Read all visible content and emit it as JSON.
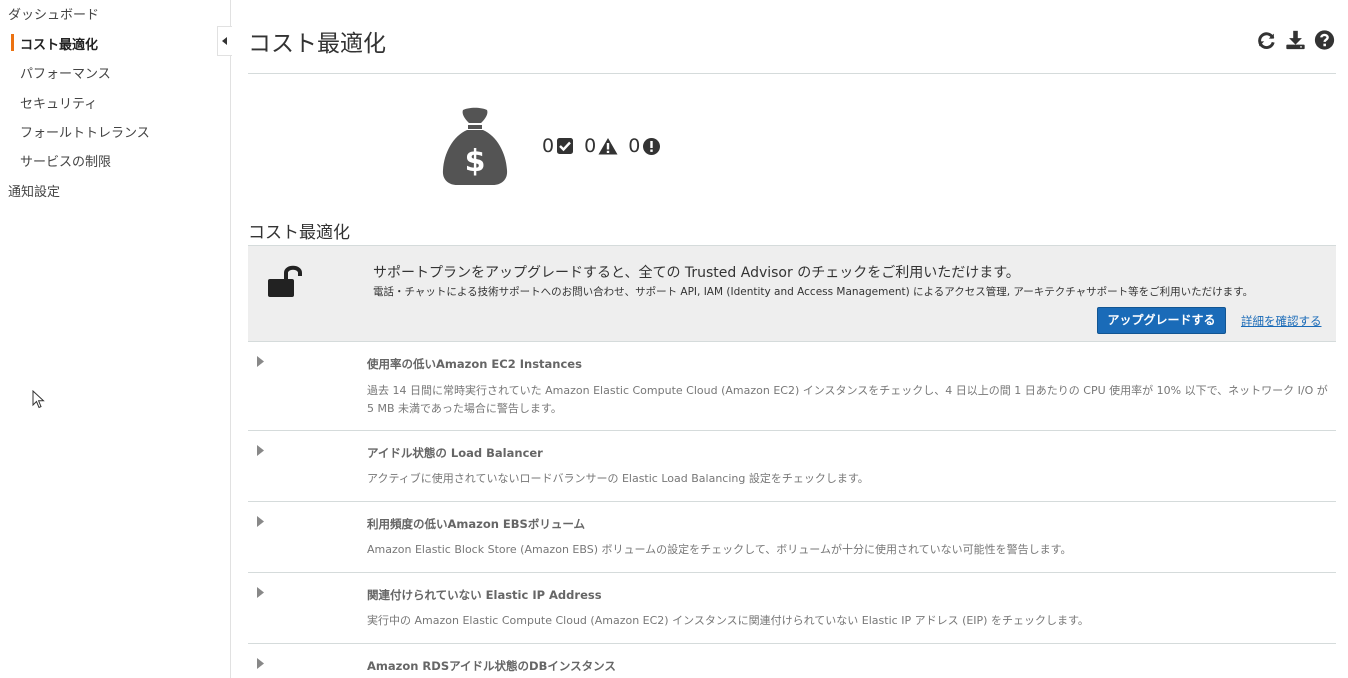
{
  "sidebar": {
    "items": [
      {
        "label": "ダッシュボード"
      },
      {
        "label": "コスト最適化"
      },
      {
        "label": "パフォーマンス"
      },
      {
        "label": "セキュリティ"
      },
      {
        "label": "フォールトトレランス"
      },
      {
        "label": "サービスの制限"
      },
      {
        "label": "通知設定"
      }
    ],
    "active_accent": "#ec7211"
  },
  "header": {
    "title": "コスト最適化",
    "icons": [
      "refresh-icon",
      "download-icon",
      "help-icon"
    ]
  },
  "summary": {
    "icon": "money-bag-icon",
    "counts": [
      {
        "value": "0",
        "icon": "check-square-icon"
      },
      {
        "value": "0",
        "icon": "warning-icon"
      },
      {
        "value": "0",
        "icon": "error-icon"
      }
    ]
  },
  "section_title": "コスト最適化",
  "upgrade": {
    "icon": "unlock-icon",
    "title": "サポートプランをアップグレードすると、全ての Trusted Advisor のチェックをご利用いただけます。",
    "subtitle": "電話・チャットによる技術サポートへのお問い合わせ、サポート API, IAM (Identity and Access Management) によるアクセス管理, アーキテクチャサポート等をご利用いただけます。",
    "button_label": "アップグレードする",
    "link_label": "詳細を確認する",
    "button_color": "#1a6bb8"
  },
  "checks": [
    {
      "title": "使用率の低いAmazon EC2 Instances",
      "description": "過去 14 日間に常時実行されていた Amazon Elastic Compute Cloud (Amazon EC2) インスタンスをチェックし、4 日以上の間 1 日あたりの CPU 使用率が 10% 以下で、ネットワーク I/O が 5 MB 未満であった場合に警告します。"
    },
    {
      "title": "アイドル状態の Load Balancer",
      "description": "アクティブに使用されていないロードバランサーの Elastic Load Balancing 設定をチェックします。"
    },
    {
      "title": "利用頻度の低いAmazon EBSボリューム",
      "description": "Amazon Elastic Block Store (Amazon EBS) ボリュームの設定をチェックして、ボリュームが十分に使用されていない可能性を警告します。"
    },
    {
      "title": "関連付けられていない Elastic IP Address",
      "description": "実行中の Amazon Elastic Compute Cloud (Amazon EC2) インスタンスに関連付けられていない Elastic IP アドレス (EIP) をチェックします。"
    },
    {
      "title": "Amazon RDSアイドル状態のDBインスタンス",
      "description": ""
    }
  ]
}
